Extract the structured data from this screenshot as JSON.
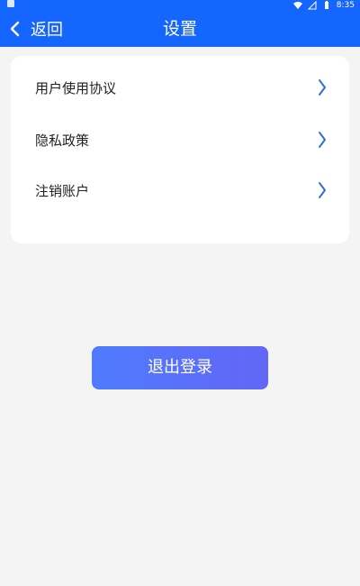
{
  "status_bar": {
    "time": "8:35"
  },
  "header": {
    "back_label": "返回",
    "title": "设置"
  },
  "settings": {
    "items": [
      {
        "label": "用户使用协议"
      },
      {
        "label": "隐私政策"
      },
      {
        "label": "注销账户"
      }
    ]
  },
  "actions": {
    "logout_label": "退出登录"
  },
  "colors": {
    "header_bg": "#1565ff",
    "chevron": "#2f6fd6",
    "logout_gradient_start": "#4f7bff",
    "logout_gradient_end": "#6266f5"
  },
  "icons": {
    "status_left": "image-notification-icon",
    "wifi": "wifi-icon",
    "signal": "no-signal-icon",
    "battery": "battery-icon",
    "back": "chevron-left-icon",
    "item_arrow": "chevron-right-icon"
  }
}
